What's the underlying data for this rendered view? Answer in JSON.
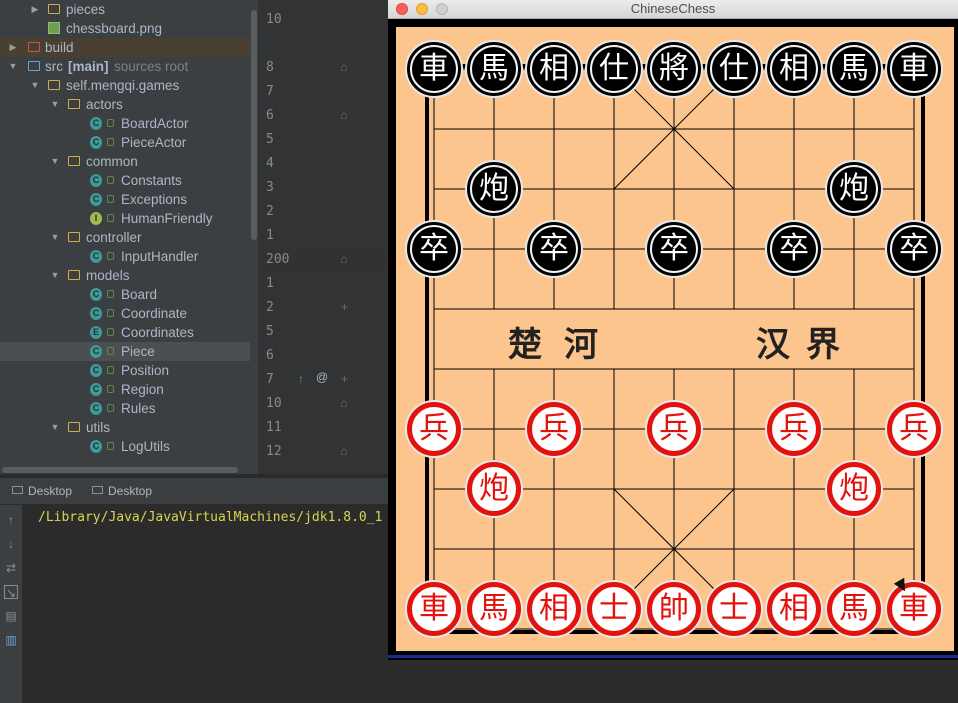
{
  "project_tree": {
    "rows": [
      {
        "label": "pieces",
        "type": "folder-closed"
      },
      {
        "label": "chessboard.png",
        "type": "image-file"
      },
      {
        "label": "build",
        "type": "folder-closed"
      },
      {
        "label": "src",
        "suffix": "[main]",
        "hint": "sources root",
        "type": "source-folder"
      },
      {
        "label": "self.mengqi.games",
        "type": "package"
      },
      {
        "label": "actors",
        "type": "package"
      },
      {
        "label": "BoardActor",
        "type": "class"
      },
      {
        "label": "PieceActor",
        "type": "class"
      },
      {
        "label": "common",
        "type": "package"
      },
      {
        "label": "Constants",
        "type": "class"
      },
      {
        "label": "Exceptions",
        "type": "class"
      },
      {
        "label": "HumanFriendly",
        "type": "interface"
      },
      {
        "label": "controller",
        "type": "package"
      },
      {
        "label": "InputHandler",
        "type": "class"
      },
      {
        "label": "models",
        "type": "package"
      },
      {
        "label": "Board",
        "type": "class"
      },
      {
        "label": "Coordinate",
        "type": "class"
      },
      {
        "label": "Coordinates",
        "type": "enum"
      },
      {
        "label": "Piece",
        "type": "class"
      },
      {
        "label": "Position",
        "type": "class"
      },
      {
        "label": "Region",
        "type": "class"
      },
      {
        "label": "Rules",
        "type": "class"
      },
      {
        "label": "utils",
        "type": "package"
      },
      {
        "label": "LogUtils",
        "type": "class"
      }
    ]
  },
  "gutter": {
    "line_numbers": [
      "10",
      "8",
      "7",
      "6",
      "5",
      "4",
      "3",
      "2",
      "1",
      "200",
      "1",
      "2",
      "5",
      "6",
      "7",
      "10",
      "11",
      "12"
    ]
  },
  "bottom_panel": {
    "tabs": [
      "Desktop",
      "Desktop"
    ],
    "console_line": "/Library/Java/JavaVirtualMachines/jdk1.8.0_1"
  },
  "app_window": {
    "title": "ChineseChess",
    "river_left": [
      "楚",
      "河"
    ],
    "river_right": [
      "汉",
      "界"
    ],
    "black_pieces": {
      "back_row": [
        "車",
        "馬",
        "相",
        "仕",
        "將",
        "仕",
        "相",
        "馬",
        "車"
      ],
      "cannons": [
        "炮",
        "炮"
      ],
      "soldiers": [
        "卒",
        "卒",
        "卒",
        "卒",
        "卒"
      ]
    },
    "red_pieces": {
      "soldiers": [
        "兵",
        "兵",
        "兵",
        "兵",
        "兵"
      ],
      "cannons": [
        "炮",
        "炮"
      ],
      "back_row": [
        "車",
        "馬",
        "相",
        "士",
        "帥",
        "士",
        "相",
        "馬",
        "車"
      ]
    }
  },
  "colors": {
    "board": "#fcc58e",
    "red": "#e3120c",
    "black": "#000000"
  }
}
